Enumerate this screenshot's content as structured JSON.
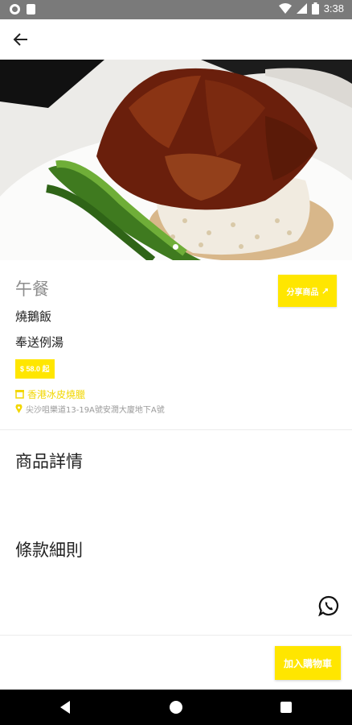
{
  "status_bar": {
    "time": "3:38"
  },
  "app_bar": {
    "back_icon": "arrow-left-icon"
  },
  "product": {
    "meal": "午餐",
    "name": "燒鵝飯",
    "extra": "奉送例湯",
    "price": "$ 58.0 起",
    "share_label": "分享商品",
    "share_icon": "link-icon"
  },
  "shop": {
    "name": "香港冰皮燒臘",
    "address": "尖沙咀樂道13-19A號安潤大廈地下A號",
    "shop_icon": "store-icon",
    "address_icon": "location-pin-icon"
  },
  "sections": {
    "details_title": "商品詳情",
    "terms_title": "條款細則"
  },
  "actions": {
    "add_to_cart": "加入購物車",
    "whatsapp_icon": "whatsapp-icon"
  },
  "colors": {
    "accent": "#ffe600",
    "shop_text": "#f2d700",
    "status_bar": "#7a7a7a"
  }
}
